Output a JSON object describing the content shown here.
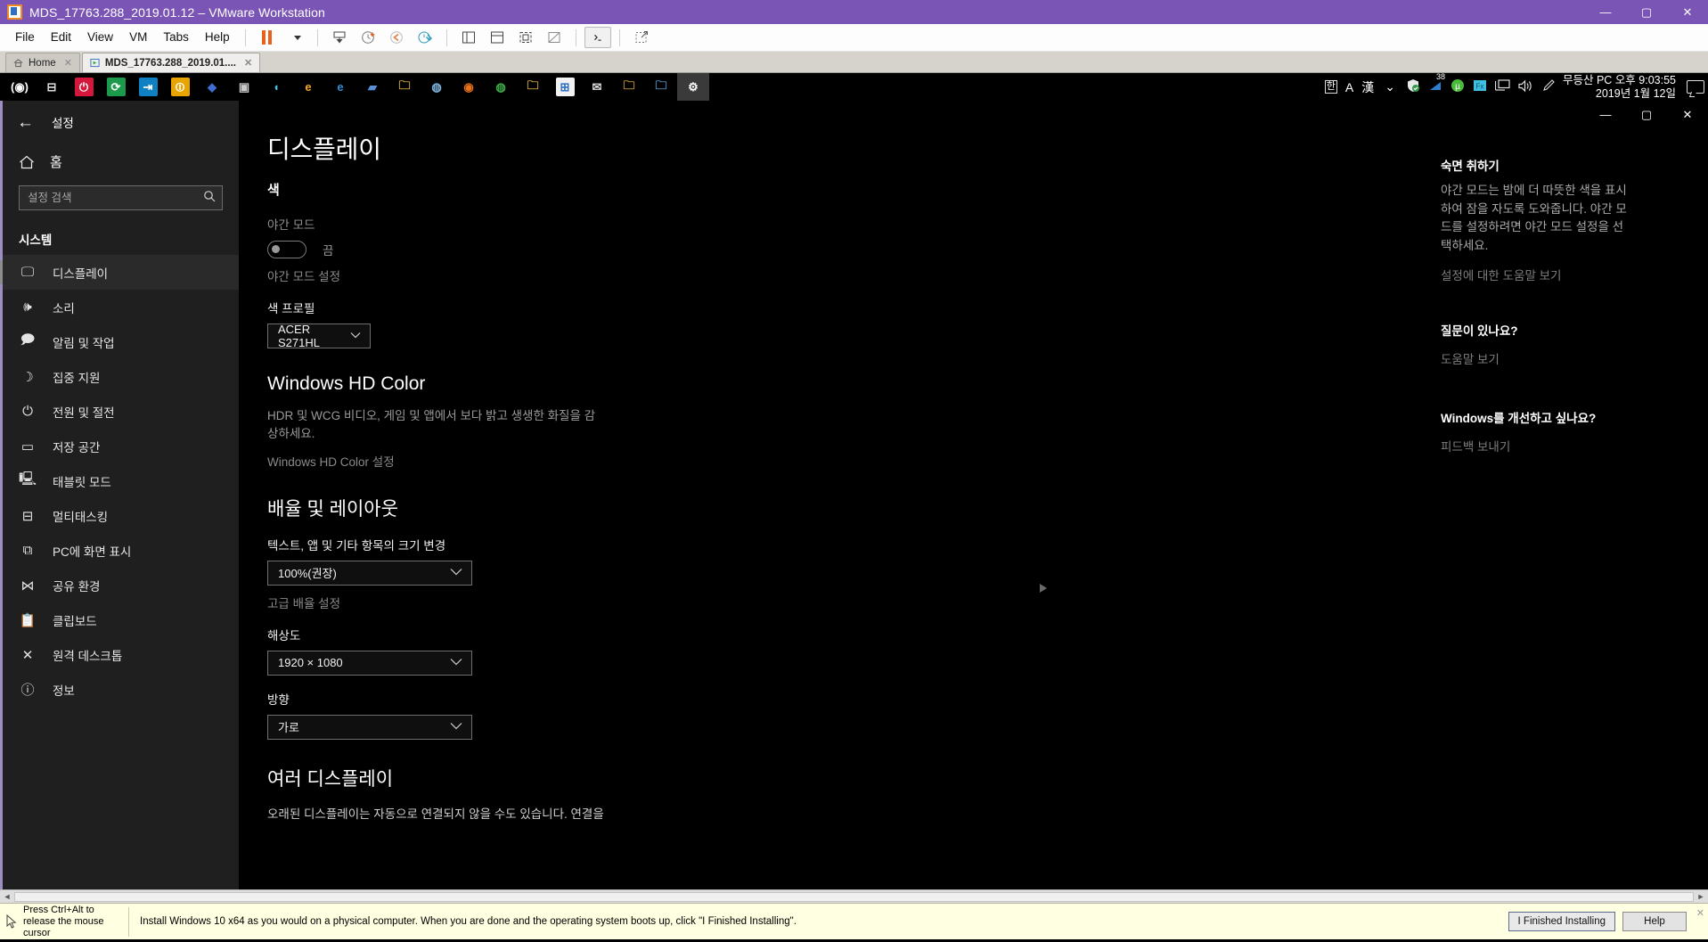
{
  "vmware": {
    "window_title": "MDS_17763.288_2019.01.12 – VMware Workstation",
    "window_controls": {
      "minimize": "—",
      "maximize": "▢",
      "close": "✕"
    },
    "menus": [
      "File",
      "Edit",
      "View",
      "VM",
      "Tabs",
      "Help"
    ],
    "tabs": [
      {
        "label": "Home",
        "close": "✕"
      },
      {
        "label": "MDS_17763.288_2019.01....",
        "close": "✕"
      }
    ]
  },
  "taskbar": {
    "apps": [
      {
        "name": "start-orb-icon",
        "glyph": "(◉)",
        "bg": "transparent",
        "fg": "#ffffff"
      },
      {
        "name": "task-view-icon",
        "glyph": "⊟",
        "bg": "transparent",
        "fg": "#dddddd"
      },
      {
        "name": "shutdown-shortcut-icon",
        "glyph": "⏻",
        "bg": "#d5173c",
        "fg": "#ffffff"
      },
      {
        "name": "restart-shortcut-icon",
        "glyph": "⟳",
        "bg": "#1a9a4a",
        "fg": "#ffffff"
      },
      {
        "name": "logoff-shortcut-icon",
        "glyph": "⇥",
        "bg": "#0f80c1",
        "fg": "#ffffff"
      },
      {
        "name": "sleep-shortcut-icon",
        "glyph": "⏼",
        "bg": "#e8a400",
        "fg": "#ffffff"
      },
      {
        "name": "nexus-icon",
        "glyph": "◆",
        "bg": "transparent",
        "fg": "#3f6fd0"
      },
      {
        "name": "monitor-utility-icon",
        "glyph": "▣",
        "bg": "transparent",
        "fg": "#c9c9c9"
      },
      {
        "name": "media-player-icon",
        "glyph": "◖",
        "bg": "transparent",
        "fg": "#45c4e8"
      },
      {
        "name": "internet-explorer-legacy-icon",
        "glyph": "e",
        "bg": "transparent",
        "fg": "#f2a818"
      },
      {
        "name": "internet-explorer-icon",
        "glyph": "e",
        "bg": "transparent",
        "fg": "#2f8fd8"
      },
      {
        "name": "remote-desktop-icon",
        "glyph": "▰",
        "bg": "transparent",
        "fg": "#5a8fd8"
      },
      {
        "name": "file-explorer-icon",
        "glyph": "🗀",
        "bg": "transparent",
        "fg": "#e8b94a"
      },
      {
        "name": "network-globe-icon",
        "glyph": "◍",
        "bg": "transparent",
        "fg": "#7fb5e0"
      },
      {
        "name": "firefox-icon",
        "glyph": "◉",
        "bg": "transparent",
        "fg": "#e8711a"
      },
      {
        "name": "chrome-icon",
        "glyph": "◍",
        "bg": "transparent",
        "fg": "#3fae4a"
      },
      {
        "name": "folder-icon",
        "glyph": "🗀",
        "bg": "transparent",
        "fg": "#e8b94a"
      },
      {
        "name": "microsoft-store-icon",
        "glyph": "⊞",
        "bg": "#f2f2f2",
        "fg": "#2f6fc2"
      },
      {
        "name": "mail-icon",
        "glyph": "✉",
        "bg": "transparent",
        "fg": "#dddddd"
      },
      {
        "name": "folder-alt-icon",
        "glyph": "🗀",
        "bg": "transparent",
        "fg": "#d8a83a"
      },
      {
        "name": "documents-icon",
        "glyph": "🗀",
        "bg": "transparent",
        "fg": "#5aa0d8"
      },
      {
        "name": "settings-gear-icon",
        "glyph": "⚙",
        "bg": "#3a3a3a",
        "fg": "#ffffff"
      }
    ],
    "ime": {
      "korean": "한",
      "alpha": "A",
      "hanja": "漢"
    },
    "tray": {
      "chevron": "⌄",
      "icons": [
        {
          "name": "security-shield-icon",
          "glyph": "🛡"
        },
        {
          "name": "network-signal-icon",
          "glyph": "◢",
          "badge": "38"
        },
        {
          "name": "utorrent-icon",
          "glyph": "µ"
        },
        {
          "name": "fx-icon",
          "glyph": "Fx"
        },
        {
          "name": "display-icon",
          "glyph": "🖵"
        },
        {
          "name": "volume-icon",
          "glyph": "🔊"
        },
        {
          "name": "pen-icon",
          "glyph": "✎"
        }
      ]
    },
    "clock": {
      "time": "무등산 PC 오후 9:03:55",
      "date": "2019년 1월 12일"
    },
    "action_center": "notification-icon"
  },
  "settings": {
    "back_label": "설정",
    "home_label": "홈",
    "search_placeholder": "설정 검색",
    "section_title": "시스템",
    "nav_items": [
      {
        "icon": "display-monitor-icon",
        "glyph": "🖵",
        "label": "디스플레이",
        "active": true
      },
      {
        "icon": "sound-speaker-icon",
        "glyph": "🕪",
        "label": "소리",
        "active": false
      },
      {
        "icon": "notification-bell-icon",
        "glyph": "🗩",
        "label": "알림 및 작업",
        "active": false
      },
      {
        "icon": "moon-icon",
        "glyph": "☽",
        "label": "집중 지원",
        "active": false
      },
      {
        "icon": "power-icon",
        "glyph": "⏻",
        "label": "전원 및 절전",
        "active": false
      },
      {
        "icon": "storage-drive-icon",
        "glyph": "▭",
        "label": "저장 공간",
        "active": false
      },
      {
        "icon": "tablet-mode-icon",
        "glyph": "🖳",
        "label": "태블릿 모드",
        "active": false
      },
      {
        "icon": "multitasking-icon",
        "glyph": "⊟",
        "label": "멀티태스킹",
        "active": false
      },
      {
        "icon": "project-to-pc-icon",
        "glyph": "⧉",
        "label": "PC에 화면 표시",
        "active": false
      },
      {
        "icon": "shared-experiences-icon",
        "glyph": "⋈",
        "label": "공유 환경",
        "active": false
      },
      {
        "icon": "clipboard-icon",
        "glyph": "📋",
        "label": "클립보드",
        "active": false
      },
      {
        "icon": "remote-desktop-icon",
        "glyph": "✕",
        "label": "원격 데스크톱",
        "active": false
      },
      {
        "icon": "about-info-icon",
        "glyph": "ⓘ",
        "label": "정보",
        "active": false
      }
    ],
    "window_controls": {
      "minimize": "—",
      "maximize": "▢",
      "close": "✕"
    },
    "main": {
      "page_title": "디스플레이",
      "color_heading": "색",
      "night_light_label": "야간 모드",
      "night_light_state": "끔",
      "night_light_settings_link": "야간 모드 설정",
      "color_profile_label": "색 프로필",
      "color_profile_value": "ACER S271HL",
      "hdr_heading": "Windows HD Color",
      "hdr_body": "HDR 및 WCG 비디오, 게임 및 앱에서 보다 밝고 생생한 화질을 감상하세요.",
      "hdr_settings_link": "Windows HD Color 설정",
      "scale_heading": "배율 및 레이아웃",
      "scale_label": "텍스트, 앱 및 기타 항목의 크기 변경",
      "scale_value": "100%(권장)",
      "advanced_scale_link": "고급 배율 설정",
      "resolution_label": "해상도",
      "resolution_value": "1920 × 1080",
      "orientation_label": "방향",
      "orientation_value": "가로",
      "multi_display_heading": "여러 디스플레이",
      "multi_display_body": "오래된 디스플레이는 자동으로 연결되지 않을 수도 있습니다. 연결을",
      "chevron": "⌄"
    },
    "right_panel": [
      {
        "title": "숙면 취하기",
        "body": "야간 모드는 밤에 더 따뜻한 색을 표시하여 잠을 자도록 도와줍니다. 야간 모드를 설정하려면 야간 모드 설정을 선택하세요.",
        "link": "설정에 대한 도움말 보기"
      },
      {
        "title": "질문이 있나요?",
        "body": "",
        "link": "도움말 보기"
      },
      {
        "title": "Windows를 개선하고 싶나요?",
        "body": "",
        "link": "피드백 보내기"
      }
    ]
  },
  "hintbar": {
    "release_text": "Press Ctrl+Alt to release the mouse cursor",
    "message": "Install Windows 10 x64 as you would on a physical computer. When you are done and the operating system boots up, click \"I Finished Installing\".",
    "primary_button": "I Finished Installing",
    "help_button": "Help",
    "close": "✕"
  }
}
